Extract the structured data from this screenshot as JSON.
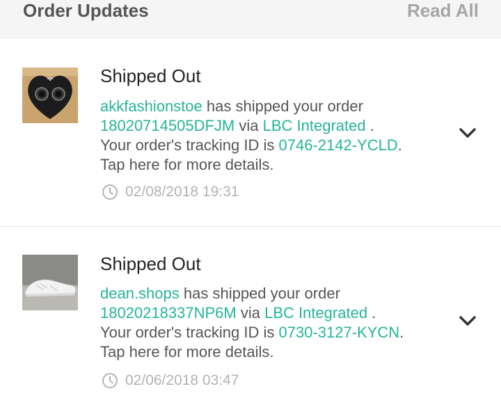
{
  "header": {
    "title": "Order Updates",
    "read_all": "Read All"
  },
  "colors": {
    "link": "#26b49a",
    "muted": "#b3b3b3",
    "text": "#555555"
  },
  "notifications": [
    {
      "heading": "Shipped Out",
      "shop": "akkfashionstoe",
      "text_1": " has shipped your order",
      "order_id": "18020714505DFJM",
      "text_2": " via ",
      "courier": "LBC Integrated",
      "text_3": " .",
      "text_4": "Your order's tracking ID is ",
      "tracking_id": "0746-2142-YCLD",
      "text_5": ".",
      "text_6": "Tap here for more details.",
      "timestamp": "02/08/2018 19:31",
      "thumbnail_icon": "watch-box-thumbnail",
      "expand_icon": "chevron-down-icon"
    },
    {
      "heading": "Shipped Out",
      "shop": "dean.shops",
      "text_1": " has shipped your order",
      "order_id": "18020218337NP6M",
      "text_2": " via ",
      "courier": "LBC Integrated",
      "text_3": " .",
      "text_4": "Your order's tracking ID is ",
      "tracking_id": "0730-3127-KYCN",
      "text_5": ".",
      "text_6": "Tap here for more details.",
      "timestamp": "02/06/2018 03:47",
      "thumbnail_icon": "sneaker-thumbnail",
      "expand_icon": "chevron-down-icon"
    }
  ]
}
